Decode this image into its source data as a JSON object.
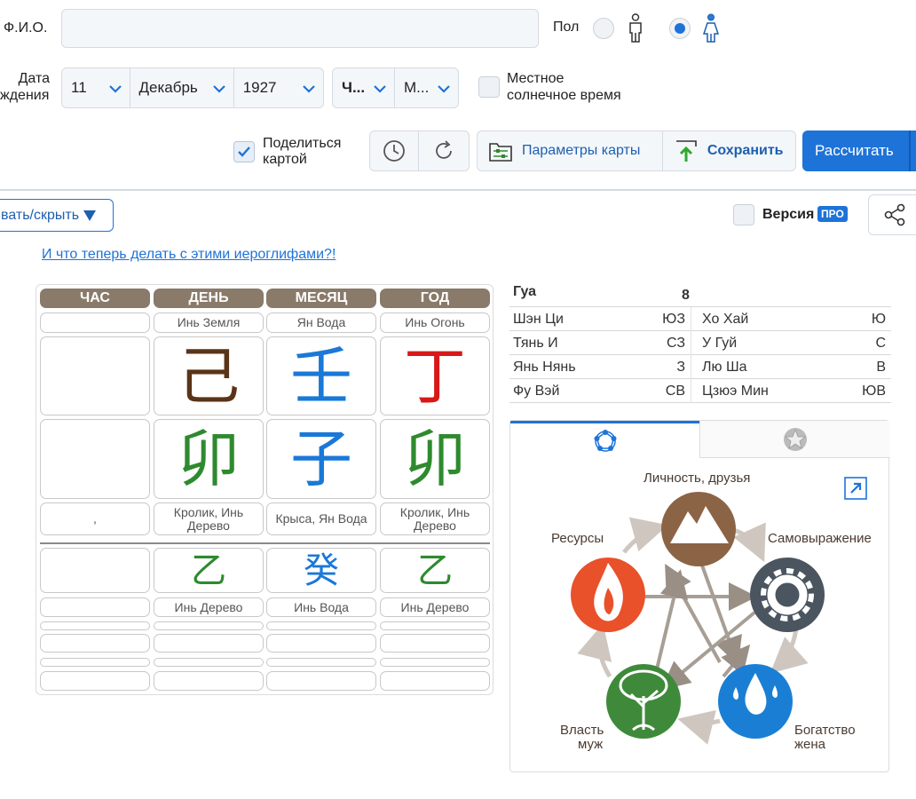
{
  "form": {
    "name_label": "Ф.И.О.",
    "name_value": "",
    "gender_label": "Пол",
    "birth_label_1": "Дата",
    "birth_label_2": "ждения",
    "day": "11",
    "month": "Декабрь",
    "year": "1927",
    "hour": "Ч...",
    "minute": "М...",
    "solar_label_1": "Местное",
    "solar_label_2": "солнечное время",
    "share_label_1": "Поделиться",
    "share_label_2": "картой",
    "params_label": "Параметры карты",
    "save_label": "Сохранить",
    "calc_label": "Рассчитать"
  },
  "toolbar": {
    "toggle_label": "вать/скрыть",
    "version_label": "Версия",
    "pro_badge": "ПРО"
  },
  "help_link": "И что теперь делать с этими иероглифами?!",
  "pillars": {
    "headers": [
      "ЧАС",
      "ДЕНЬ",
      "МЕСЯЦ",
      "ГОД"
    ],
    "stem_names": [
      "",
      "Инь Земля",
      "Ян Вода",
      "Инь Огонь"
    ],
    "stems": [
      "",
      "己",
      "壬",
      "丁"
    ],
    "stem_colors": [
      "#000000",
      "#5a3418",
      "#1a78d8",
      "#d81818"
    ],
    "branches": [
      "",
      "卯",
      "子",
      "卯"
    ],
    "branch_colors": [
      "#000000",
      "#2e8a2e",
      "#1a78d8",
      "#2e8a2e"
    ],
    "branch_names": [
      ",",
      "Кролик, Инь Дерево",
      "Крыса, Ян Вода",
      "Кролик, Инь Дерево"
    ],
    "hidden": [
      "",
      "乙",
      "癸",
      "乙"
    ],
    "hidden_colors": [
      "#000000",
      "#2e8a2e",
      "#1a78d8",
      "#2e8a2e"
    ],
    "hidden_names": [
      "",
      "Инь Дерево",
      "Инь Вода",
      "Инь Дерево"
    ]
  },
  "gua": {
    "label": "Гуа",
    "value": "8",
    "rows": [
      {
        "l_name": "Шэн Ци",
        "l_dir": "ЮЗ",
        "r_name": "Хо Хай",
        "r_dir": "Ю"
      },
      {
        "l_name": "Тянь И",
        "l_dir": "СЗ",
        "r_name": "У Гуй",
        "r_dir": "С"
      },
      {
        "l_name": "Янь Нянь",
        "l_dir": "З",
        "r_name": "Лю Ша",
        "r_dir": "В"
      },
      {
        "l_name": "Фу Вэй",
        "l_dir": "СВ",
        "r_name": "Цзюэ Мин",
        "r_dir": "ЮВ"
      }
    ]
  },
  "elements": {
    "top": "Личность, друзья",
    "right": "Самовыражение",
    "left": "Ресурсы",
    "bottom_left_1": "Власть",
    "bottom_left_2": "муж",
    "bottom_right_1": "Богатство",
    "bottom_right_2": "жена"
  },
  "colors": {
    "accent": "#1e73d8",
    "pillar_header": "#8a7a6a"
  }
}
